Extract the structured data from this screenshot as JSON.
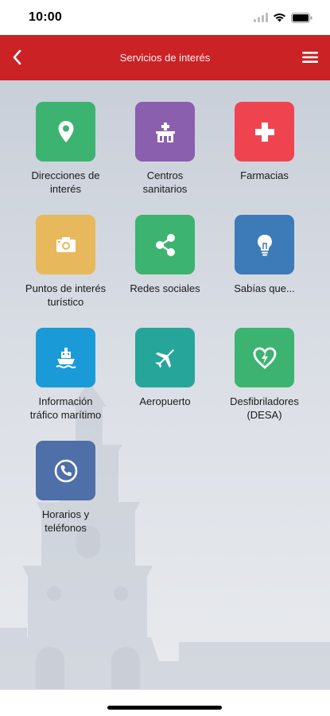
{
  "status_bar": {
    "time": "10:00"
  },
  "header": {
    "title": "Servicios de interés",
    "color": "#cb2226"
  },
  "tiles": [
    {
      "label": "Direcciones de\ninterés",
      "color": "#3cb371",
      "icon": "map-pin-icon"
    },
    {
      "label": "Centros\nsanitarios",
      "color": "#8a5fae",
      "icon": "hospital-icon"
    },
    {
      "label": "Farmacias",
      "color": "#ef4450",
      "icon": "pharmacy-cross-icon"
    },
    {
      "label": "Puntos de interés\nturístico",
      "color": "#e8b95c",
      "icon": "camera-icon"
    },
    {
      "label": "Redes sociales",
      "color": "#3cb371",
      "icon": "share-icon"
    },
    {
      "label": "Sabías que...",
      "color": "#3d7ab8",
      "icon": "lightbulb-icon"
    },
    {
      "label": "Información\ntráfico marítimo",
      "color": "#1a9bd7",
      "icon": "ship-icon"
    },
    {
      "label": "Aeropuerto",
      "color": "#26a69a",
      "icon": "airplane-icon"
    },
    {
      "label": "Desfibriladores\n(DESA)",
      "color": "#3cb371",
      "icon": "defibrillator-heart-icon"
    },
    {
      "label": "Horarios y\nteléfonos",
      "color": "#4e6fa7",
      "icon": "phone-icon"
    }
  ]
}
